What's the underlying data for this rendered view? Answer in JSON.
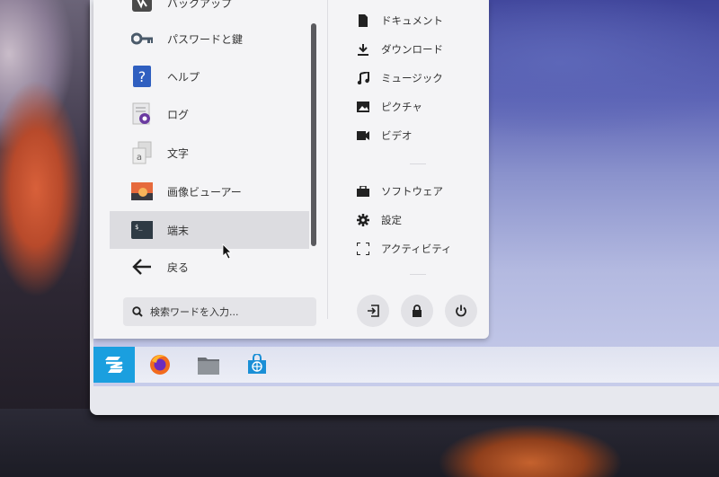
{
  "apps": [
    {
      "label": "バックアップ",
      "icon": "backup-icon"
    },
    {
      "label": "パスワードと鍵",
      "icon": "key-icon"
    },
    {
      "label": "ヘルプ",
      "icon": "help-icon"
    },
    {
      "label": "ログ",
      "icon": "log-viewer-icon"
    },
    {
      "label": "文字",
      "icon": "characters-icon"
    },
    {
      "label": "画像ビューアー",
      "icon": "image-viewer-icon"
    },
    {
      "label": "端末",
      "icon": "terminal-icon"
    },
    {
      "label": "戻る",
      "icon": "back-arrow-icon"
    }
  ],
  "search": {
    "placeholder": "検索ワードを入力..."
  },
  "places": [
    {
      "label": "ドキュメント",
      "icon": "document-icon"
    },
    {
      "label": "ダウンロード",
      "icon": "download-icon"
    },
    {
      "label": "ミュージック",
      "icon": "music-icon"
    },
    {
      "label": "ピクチャ",
      "icon": "picture-icon"
    },
    {
      "label": "ビデオ",
      "icon": "video-icon"
    }
  ],
  "system": [
    {
      "label": "ソフトウェア",
      "icon": "briefcase-icon"
    },
    {
      "label": "設定",
      "icon": "gear-icon"
    },
    {
      "label": "アクティビティ",
      "icon": "activities-icon"
    }
  ],
  "actions": [
    "logout-icon",
    "lock-icon",
    "power-icon"
  ],
  "taskbar": [
    "zorin-menu-icon",
    "firefox-icon",
    "files-icon",
    "software-store-icon"
  ],
  "colors": {
    "accent": "#1a9fdf",
    "menu_bg": "#f4f4f6",
    "selected_bg": "#dcdce0"
  }
}
